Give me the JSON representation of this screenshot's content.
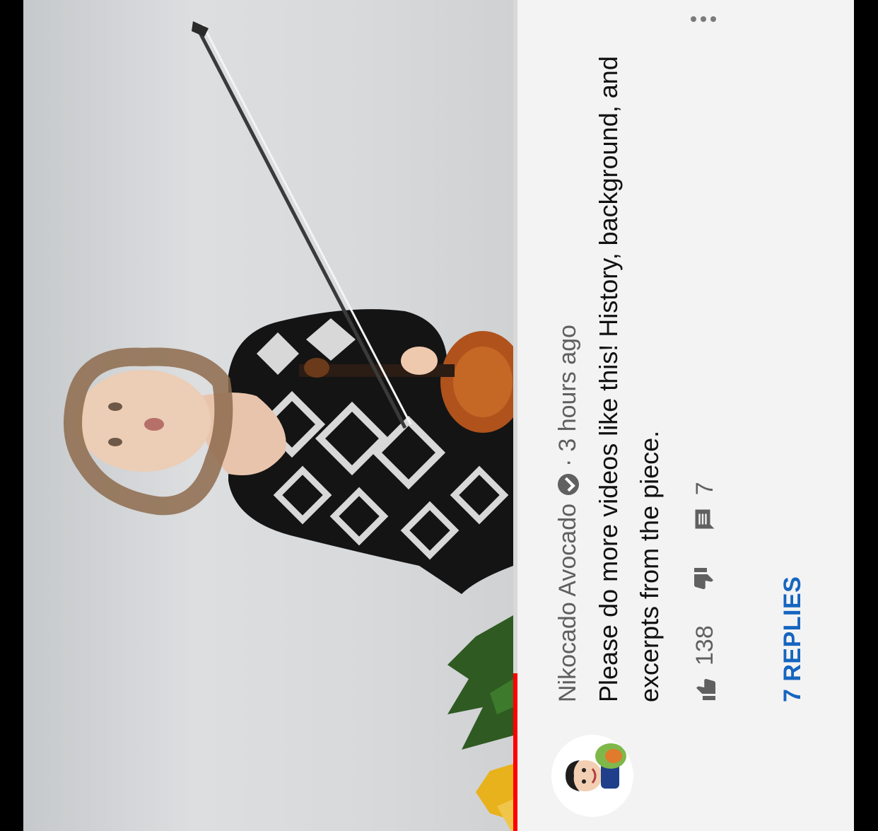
{
  "video": {
    "description_icon": "violinist-video-frame",
    "progress_fraction": 0.19
  },
  "comment": {
    "author": "Nikocado Avocado",
    "verified_icon": "verified-check-icon",
    "separator": "·",
    "timestamp": "3 hours ago",
    "text": "Please do more videos like this! History, background, and excerpts from the piece.",
    "likes": "138",
    "replies_count": "7",
    "replies_label": "7 REPLIES",
    "more_icon": "more-vert-icon"
  },
  "colors": {
    "panel_bg": "#f3f3f3",
    "link_blue": "#1565c0",
    "progress_red": "#ff0000",
    "meta_gray": "#606060"
  }
}
